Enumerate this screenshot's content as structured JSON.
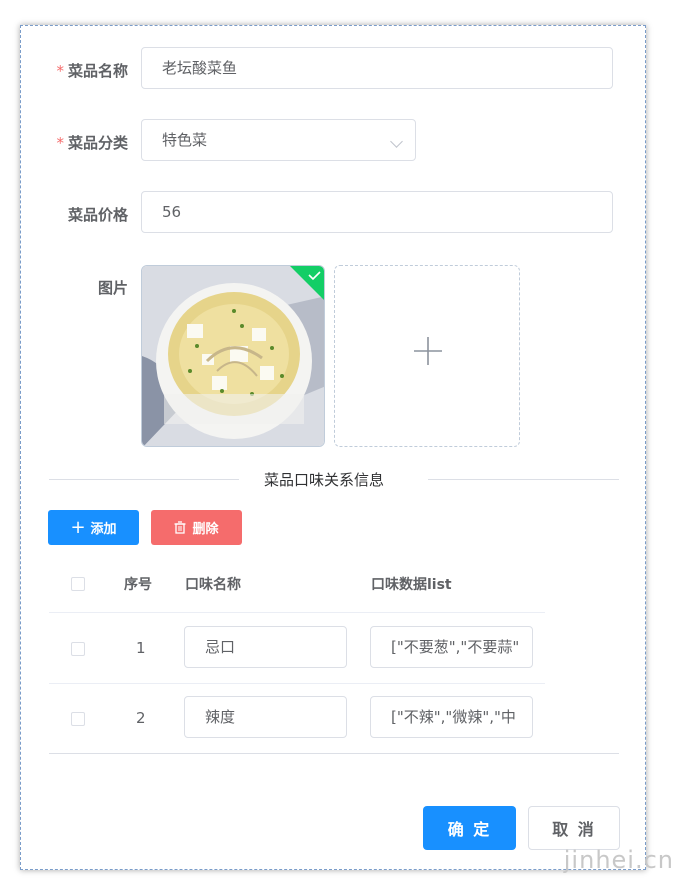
{
  "form": {
    "name": {
      "label": "菜品名称",
      "required_mark": "*",
      "value": "老坛酸菜鱼"
    },
    "category": {
      "label": "菜品分类",
      "required_mark": "*",
      "value": "特色菜"
    },
    "price": {
      "label": "菜品价格",
      "value": "56"
    },
    "image": {
      "label": "图片",
      "plus": "+"
    }
  },
  "divider": {
    "text": "菜品口味关系信息"
  },
  "toolbar": {
    "add_label": "添加",
    "add_icon": "+",
    "delete_label": "删除"
  },
  "table": {
    "headers": {
      "index": "序号",
      "name": "口味名称",
      "data": "口味数据list"
    },
    "rows": [
      {
        "index": "1",
        "name": "忌口",
        "data": "[\"不要葱\",\"不要蒜\""
      },
      {
        "index": "2",
        "name": "辣度",
        "data": "[\"不辣\",\"微辣\",\"中"
      }
    ]
  },
  "footer": {
    "confirm_label": "确 定",
    "cancel_label": "取 消"
  },
  "watermark": "jinhei.cn",
  "colors": {
    "primary": "#1890ff",
    "danger": "#f56c6c",
    "required": "#f56c6c",
    "success": "#13ce66"
  }
}
